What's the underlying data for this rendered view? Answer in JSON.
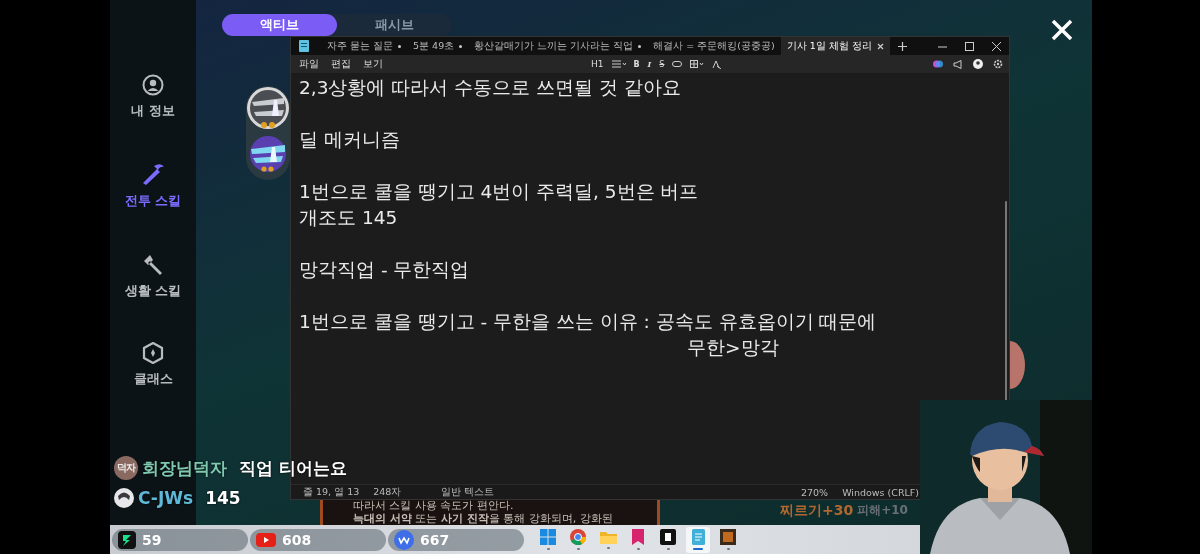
{
  "game": {
    "tabs": [
      {
        "label": "액티브",
        "selected": true
      },
      {
        "label": "패시브",
        "selected": false
      }
    ],
    "sidebar": [
      {
        "label": "내 정보",
        "selected": false
      },
      {
        "label": "전투 스킬",
        "selected": true
      },
      {
        "label": "생활 스킬",
        "selected": false
      },
      {
        "label": "클래스",
        "selected": false
      }
    ],
    "description": [
      "따라서 스킬 사용 속도가 편안다.",
      "**늑대의 서약** 또는 **사기 진작**을 통해 강화되며, 강화된"
    ],
    "stats": [
      "찌르기+30",
      "피해+10"
    ]
  },
  "notepad": {
    "tabs": [
      {
        "label": "자주 묻는 질문",
        "modified": true,
        "selected": false
      },
      {
        "label": "5분 49초",
        "modified": true,
        "selected": false
      },
      {
        "label": "황산갈매기가 느끼는 기사라는 직업",
        "modified": true,
        "selected": false
      },
      {
        "label": "해결사 = 주문해킹(공중공)",
        "modified": false,
        "selected": false
      },
      {
        "label": "기사 1일 체험 정리",
        "modified": false,
        "selected": true
      }
    ],
    "menu": [
      "파일",
      "편집",
      "보기"
    ],
    "heading": "H1",
    "format_buttons": [
      "B",
      "I",
      "S"
    ],
    "paragraphs": [
      [
        {
          "text": "2,3상황에 따라서 수동으로 쓰면될 것 같아요",
          "indent": false
        }
      ],
      [
        {
          "text": "딜 메커니즘",
          "indent": false
        }
      ],
      [
        {
          "text": "1번으로 쿨을 땡기고 4번이 주력딜, 5번은 버프",
          "indent": false
        },
        {
          "text": "개조도 145",
          "indent": false
        }
      ],
      [
        {
          "text": "망각직업 - 무한직업",
          "indent": false
        }
      ],
      [
        {
          "text": "1번으로 쿨을 땡기고 - 무한을 쓰는 이유 : 공속도 유효옵이기 때문에",
          "indent": false
        },
        {
          "text": "무한>망각",
          "indent": true
        }
      ]
    ],
    "status": {
      "position": "줄 19, 열 13",
      "chars": "248자",
      "format": "일반 텍스트",
      "zoom": "270%",
      "encoding": "Windows (CRLF)"
    }
  },
  "chat": [
    {
      "badge": "덕자",
      "user": "회장님덕자",
      "message": "직업 티어는요",
      "color": "#7fc9b0"
    },
    {
      "user": "C-JWs",
      "message": "145",
      "color": "#5fb8d8"
    }
  ],
  "viewers": [
    {
      "kind": "chzzk",
      "count": "59"
    },
    {
      "kind": "youtube",
      "count": "608"
    },
    {
      "kind": "we",
      "count": "667"
    }
  ],
  "taskbar": [
    {
      "kind": "start",
      "active": false
    },
    {
      "kind": "browser",
      "active": false
    },
    {
      "kind": "folder",
      "active": false
    },
    {
      "kind": "bookmark",
      "active": false
    },
    {
      "kind": "app",
      "active": false
    },
    {
      "kind": "notepad",
      "active": true
    },
    {
      "kind": "game",
      "active": false
    }
  ]
}
